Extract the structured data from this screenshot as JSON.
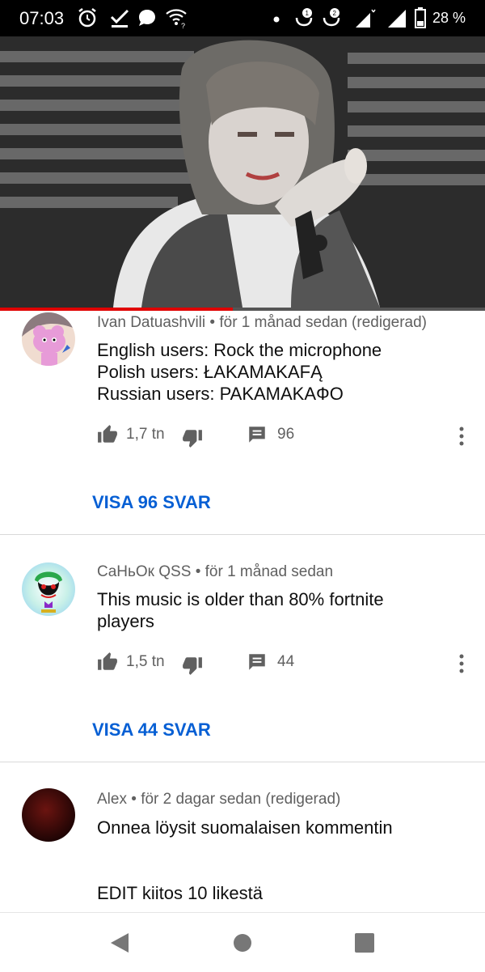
{
  "status_bar": {
    "time": "07:03",
    "battery": "28 %",
    "icons": [
      "alarm-icon",
      "task-check-icon",
      "chat-bubble-icon",
      "wifi-question-icon",
      "dot-icon",
      "mobile-data-1-icon",
      "mobile-data-2-icon",
      "signal-1-icon",
      "signal-2-icon",
      "battery-icon"
    ]
  },
  "video": {
    "progress_fraction": 0.48,
    "colors": {
      "progress": "#e00000"
    }
  },
  "comments": [
    {
      "author": "Ivan Datuashvili",
      "time": "för 1 månad sedan (redigerad)",
      "lines": [
        "English users: Rock the microphone",
        "Polish users: ŁAKAMAKAFĄ",
        "Russian users: PAKAMAKAФО"
      ],
      "likes": "1,7 tn",
      "reply_count": "96",
      "view_replies": "VISA 96 SVAR"
    },
    {
      "author": "CaНьОк QSS",
      "time": "för 1 månad sedan",
      "lines": [
        "This music is older than 80% fortnite",
        "players"
      ],
      "likes": "1,5 tn",
      "reply_count": "44",
      "view_replies": "VISA 44 SVAR"
    },
    {
      "author": "Alex",
      "time": "för 2 dagar sedan (redigerad)",
      "lines": [
        "Onnea löysit suomalaisen kommentin",
        "EDIT kiitos 10 likestä"
      ]
    }
  ],
  "colors": {
    "link": "#065fd4",
    "meta": "#606060",
    "text": "#0f0f0f"
  }
}
